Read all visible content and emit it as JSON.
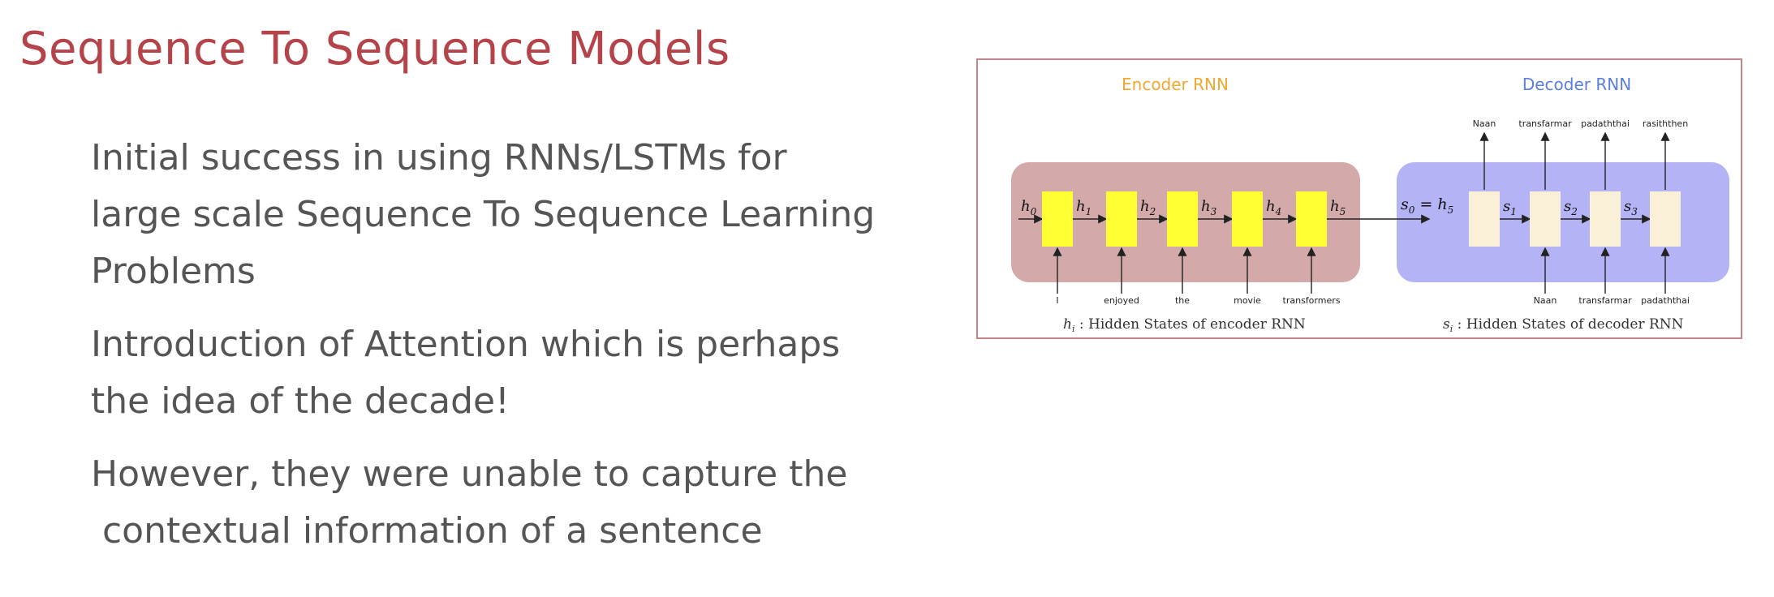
{
  "slide": {
    "title": "Sequence To Sequence Models",
    "bullets": [
      {
        "lines": [
          "Initial success in using RNNs/LSTMs for",
          "large scale Sequence To Sequence Learning",
          "Problems"
        ]
      },
      {
        "lines": [
          "Introduction of Attention which is perhaps",
          "the idea of the decade!"
        ]
      },
      {
        "lines": [
          "However, they were unable to capture the",
          " contextual information of a sentence"
        ]
      }
    ]
  },
  "diagram": {
    "encoder": {
      "title": "Encoder RNN",
      "states": [
        "h0",
        "h1",
        "h2",
        "h3",
        "h4",
        "h5"
      ],
      "inputs": [
        "I",
        "enjoyed",
        "the",
        "movie",
        "transformers"
      ],
      "caption_sym": "h",
      "caption_sub": "i",
      "caption_text": " : Hidden States of encoder RNN",
      "fill_color": "#d4a9aa",
      "cell_color": "#ffff33"
    },
    "decoder": {
      "title": "Decoder RNN",
      "init_state": "s0 = h5",
      "states": [
        "s1",
        "s2",
        "s3"
      ],
      "outputs": [
        "Naan",
        "transfarmar",
        "padaththai",
        "rasiththen"
      ],
      "inputs": [
        "Naan",
        "transfarmar",
        "padaththai"
      ],
      "caption_sym": "s",
      "caption_sub": "i",
      "caption_text": " : Hidden States of decoder RNN",
      "fill_color": "#b3b3f5",
      "cell_color": "#faf0d8"
    },
    "colors": {
      "encoder_title": "#f0a830",
      "decoder_title": "#5a7fdc",
      "title_text": "#b5444a",
      "bullet_text": "#555555",
      "frame": "#c6838a"
    }
  }
}
